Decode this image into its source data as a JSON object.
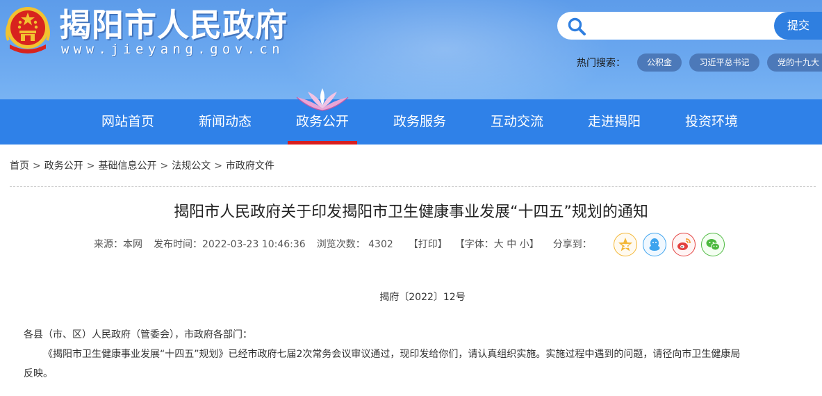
{
  "header": {
    "site_title": "揭阳市人民政府",
    "site_url": "www.jieyang.gov.cn",
    "search": {
      "placeholder": "",
      "submit_label": "提交"
    },
    "hot_search_label": "热门搜索：",
    "hot_tags": [
      "公积金",
      "习近平总书记",
      "党的十九大"
    ]
  },
  "nav": {
    "items": [
      "网站首页",
      "新闻动态",
      "政务公开",
      "政务服务",
      "互动交流",
      "走进揭阳",
      "投资环境"
    ],
    "active_index": 2
  },
  "breadcrumb": [
    "首页",
    "政务公开",
    "基础信息公开",
    "法规公文",
    "市政府文件"
  ],
  "article": {
    "title": "揭阳市人民政府关于印发揭阳市卫生健康事业发展“十四五”规划的通知",
    "meta": {
      "source": "来源：本网",
      "publish_time": "发布时间：2022-03-23 10:46:36",
      "views": "浏览次数： 4302",
      "print": "【打印】",
      "font_size": "【字体：大 中 小】",
      "share_label": "分享到："
    },
    "share_icons": [
      "qzone-icon",
      "qq-icon",
      "weibo-icon",
      "wechat-icon"
    ],
    "doc_number": "揭府〔2022〕12号",
    "salutation": "各县（市、区）人民政府（管委会），市政府各部门：",
    "body_line1": "《揭阳市卫生健康事业发展“十四五”规划》已经市政府七届2次常务会议审议通过，现印发给你们，请认真组织实施。实施过程中遇到的问题，请径向市卫生健康局",
    "body_line2": "反映。"
  },
  "colors": {
    "header_bg": "#6aa7ef",
    "nav_bg": "#2f81e8",
    "nav_active_underline": "#d81e1e",
    "search_button": "#2f7fe0",
    "hot_tag_bg": "#4c79b9"
  }
}
